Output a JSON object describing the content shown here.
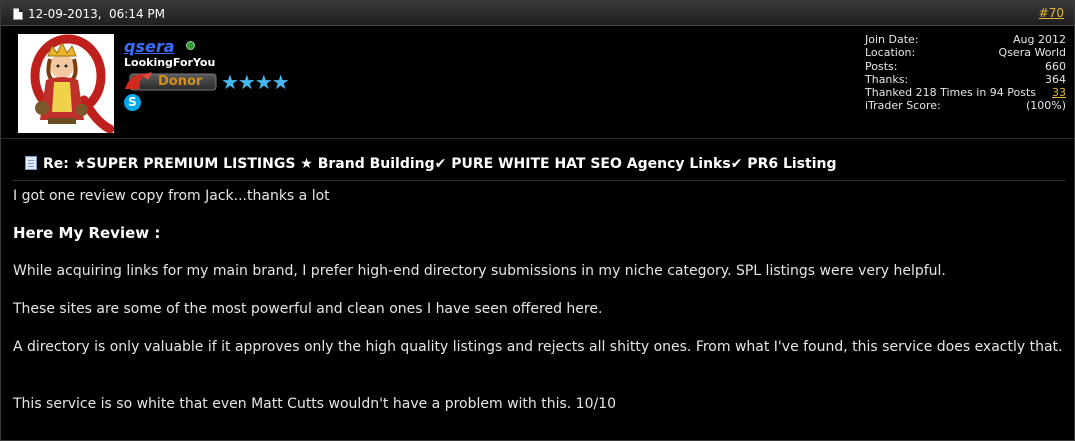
{
  "header": {
    "date": "12-09-2013,",
    "time": "06:14 PM",
    "post_number": "#70"
  },
  "user": {
    "name": "qsera",
    "title": "LookingForYou",
    "badge": "Donor",
    "stars": "★★★★",
    "online_status": "online",
    "contact_icon": "skype-icon"
  },
  "stats": [
    {
      "label": "Join Date:",
      "value": "Aug 2012"
    },
    {
      "label": "Location:",
      "value": "Qsera World"
    },
    {
      "label": "Posts:",
      "value": "660"
    },
    {
      "label": "Thanks:",
      "value": "364"
    },
    {
      "label": "Thanked 218 Times in 94 Posts",
      "value": "33"
    },
    {
      "label": "iTrader Score:",
      "value": "(100%)"
    }
  ],
  "post": {
    "title": "Re: ★SUPER PREMIUM LISTINGS ★ Brand Building✔ PURE WHITE HAT SEO Agency Links✔ PR6 Listing",
    "paragraphs": [
      "I got one review copy from Jack...thanks a lot",
      "Here My Review :",
      "While acquiring links for my main brand, I prefer high-end directory submissions in my niche category. SPL listings were very helpful.",
      "These sites are some of the most powerful and clean ones I have seen offered here.",
      "A directory is only valuable if it approves only the high quality listings and rejects all shitty ones. From what I've found, this service does exactly that.",
      "This service is so white that even Matt Cutts wouldn't have a problem with this. 10/10"
    ]
  },
  "colors": {
    "background": "#000000",
    "header_bar": "#2b2b2b",
    "username": "#3b6cff",
    "link": "#e5b53a",
    "stars": "#45b8f0",
    "donor": "#d48f19"
  }
}
